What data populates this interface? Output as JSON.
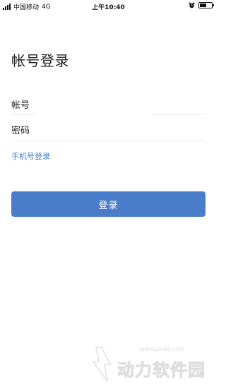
{
  "status_bar": {
    "carrier": "中国移动",
    "network": "4G",
    "time": "上午10:40",
    "icons": [
      "signal-icon",
      "alarm-icon",
      "battery-icon"
    ],
    "battery_level": 0.55
  },
  "page": {
    "title": "帐号登录"
  },
  "form": {
    "account_label": "帐号",
    "account_value": "",
    "account_placeholder": "",
    "password_label": "密码",
    "password_value": "",
    "password_placeholder": ""
  },
  "links": {
    "phone_login": "手机号登录"
  },
  "buttons": {
    "login": "登录"
  },
  "watermark": {
    "url": "www.pw88.com",
    "name": "动力软件园"
  },
  "colors": {
    "accent": "#4a7dc9",
    "link": "#3d7cc9",
    "background": "#ffffff",
    "divider": "#ebebeb"
  }
}
